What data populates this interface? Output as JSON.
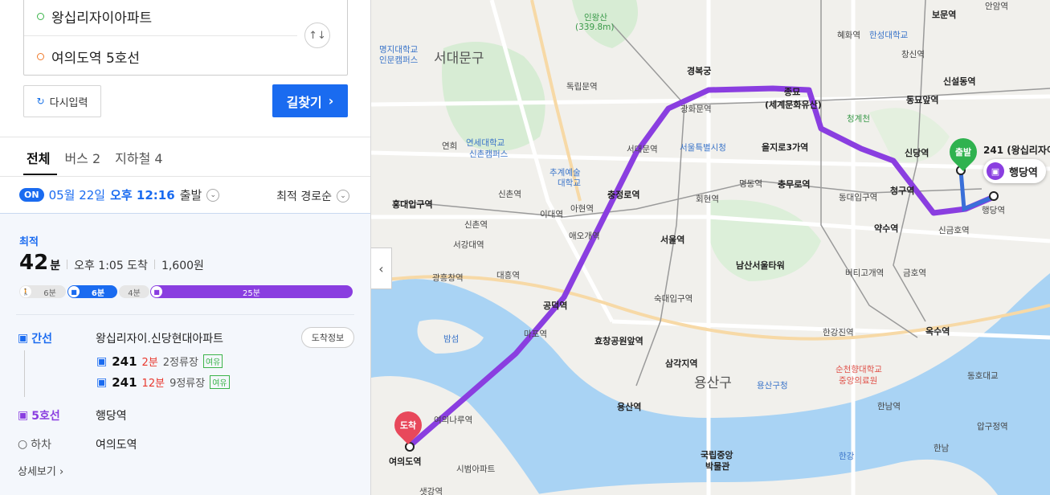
{
  "search": {
    "origin": "왕십리자이아파트",
    "destination": "여의도역 5호선",
    "swap_icon": "↑↓",
    "reset_label": "다시입력",
    "search_label": "길찾기"
  },
  "tabs": [
    {
      "label": "전체"
    },
    {
      "label": "버스 2"
    },
    {
      "label": "지하철 4"
    }
  ],
  "departure": {
    "on_badge": "ON",
    "date": "05월 22일",
    "time": "오후 12:16",
    "suffix": "출발",
    "sort_label": "최적 경로순"
  },
  "route": {
    "best_label": "최적",
    "minutes": "42",
    "minutes_unit": "분",
    "arrival": "오후 1:05 도착",
    "fare": "1,600원",
    "bar": {
      "walk1": "6분",
      "bus": "6분",
      "walk2": "4분",
      "subway": "25분"
    },
    "steps": {
      "bus_label": "간선",
      "bus_stop": "왕십리자이.신당현대아파트",
      "arrival_info": "도착정보",
      "bus_lines": [
        {
          "num": "241",
          "eta": "2분",
          "stops": "2정류장",
          "status": "여유"
        },
        {
          "num": "241",
          "eta": "12분",
          "stops": "9정류장",
          "status": "여유"
        }
      ],
      "subway_label": "5호선",
      "subway_stop": "행당역",
      "off_label": "하차",
      "off_stop": "여의도역"
    },
    "detail_link": "상세보기"
  },
  "map": {
    "colors": {
      "subway": "#8a3ee0",
      "bus": "#3a6fd8",
      "start": "#2fb24f",
      "end": "#e8485b"
    },
    "start_pin": "출발",
    "end_pin": "도착",
    "stop_chip": "행당역",
    "bus_route_label": "241 (왕십리자이",
    "collapse_icon": "‹",
    "labels": {
      "inwangsan": "인왕산",
      "inwangsan_h": "(339.8m)",
      "myongji": "명지대학교",
      "myongji2": "인문캠퍼스",
      "seodaemun": "서대문구",
      "gyeongbokgung": "경복궁",
      "dongnimmun": "독립문역",
      "gwanghwamun": "광화문역",
      "jongmyo": "종묘",
      "jongmyo2": "(세계문화유산)",
      "hyehwa": "혜화역",
      "hansung": "한성대학교",
      "changsin": "창신역",
      "sinseoldong": "신설동역",
      "dongmyo": "동묘앞역",
      "cheonggyecheon": "청계천",
      "yonsei": "연세대학교",
      "yonsei2": "신촌캠퍼스",
      "yeonhui": "연희",
      "seodaemunst": "서대문역",
      "cityhall": "서울특별시청",
      "euljiro": "을지로3가역",
      "sindang": "신당역",
      "chugye": "추계예술",
      "chugye2": "대학교",
      "chungjeongno": "충정로역",
      "myeongdong": "명동역",
      "chungmuro": "충무로역",
      "dongdaeipgu": "동대입구역",
      "cheonggu": "청구역",
      "hongik": "홍대입구역",
      "sinchon": "신촌역",
      "ewha": "이대역",
      "ahyeon": "아현역",
      "hoehyeon": "회현역",
      "yaksu": "약수역",
      "singeumho": "신금호역",
      "haengdang": "행당역",
      "sinchon2": "신촌역",
      "seogang": "서강대역",
      "aeogae": "애오개역",
      "seoulst": "서울역",
      "namsan": "남산서울타워",
      "beotigogae": "버티고개역",
      "geumho": "금호역",
      "gwangheungchang": "광흥창역",
      "daeheung": "대흥역",
      "gongdeok": "공덕역",
      "sookmyung": "숙대입구역",
      "mapo": "마포역",
      "hyochang": "효창공원앞역",
      "samgakji": "삼각지역",
      "hangangjin": "한강진역",
      "oksu": "옥수역",
      "soonchunhyang": "순천향대학교",
      "soonchunhyang2": "중앙의료원",
      "yongsangu": "용산구",
      "yongsangu_office": "용산구청",
      "yongsan": "용산역",
      "hannam": "한남역",
      "yeouinaru": "여의나루역",
      "museum": "국립중앙",
      "museum2": "박물관",
      "yeouido": "여의도역",
      "citypark": "시범아파트",
      "saetgang": "샛강역",
      "han": "한강",
      "apgujeong": "압구정역",
      "dongho": "동호대교",
      "hannam2": "한남",
      "bomun": "보문역",
      "anam": "안암역",
      "bamseom": "밤섬",
      "sinchonc": "신촌역"
    }
  }
}
